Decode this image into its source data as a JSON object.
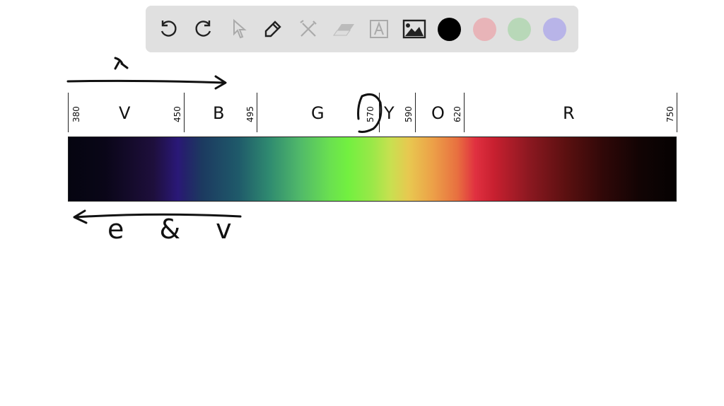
{
  "toolbar": {
    "tools": [
      "undo-icon",
      "redo-icon",
      "pointer-icon",
      "pen-icon",
      "tools-icon",
      "eraser-icon",
      "text-icon",
      "image-icon"
    ],
    "colors": [
      "#000000",
      "#e8b4b8",
      "#b8d8b8",
      "#b8b4e8"
    ]
  },
  "spectrum": {
    "boundaries": [
      "380",
      "450",
      "495",
      "570",
      "590",
      "620",
      "750"
    ],
    "bands": [
      "V",
      "B",
      "G",
      "Y",
      "O",
      "R"
    ]
  },
  "annotations": {
    "lambda": "λ",
    "note": "e & v"
  }
}
